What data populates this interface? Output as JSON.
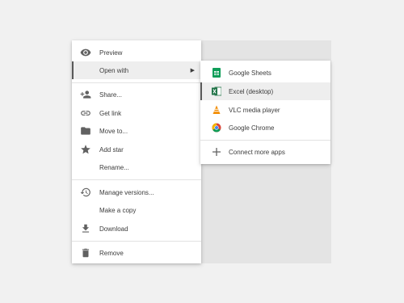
{
  "main_menu": {
    "preview": "Preview",
    "open_with": "Open with",
    "share": "Share...",
    "get_link": "Get link",
    "move_to": "Move to...",
    "add_star": "Add star",
    "rename": "Rename...",
    "manage_versions": "Manage versions...",
    "make_copy": "Make a copy",
    "download": "Download",
    "remove": "Remove"
  },
  "submenu": {
    "google_sheets": "Google Sheets",
    "excel": "Excel (desktop)",
    "vlc": "VLC media player",
    "chrome": "Google Chrome",
    "connect_more": "Connect more apps"
  },
  "colors": {
    "icon_gray": "#616161",
    "sheets_green": "#0f9d58",
    "excel_green": "#1e7145",
    "vlc_orange": "#f28b00"
  },
  "icons": [
    "eye-icon",
    "chevron-right-icon",
    "add-person-icon",
    "link-icon",
    "folder-icon",
    "star-icon",
    "history-icon",
    "download-icon",
    "trash-icon",
    "google-sheets-icon",
    "excel-icon",
    "vlc-icon",
    "chrome-icon",
    "plus-icon"
  ]
}
